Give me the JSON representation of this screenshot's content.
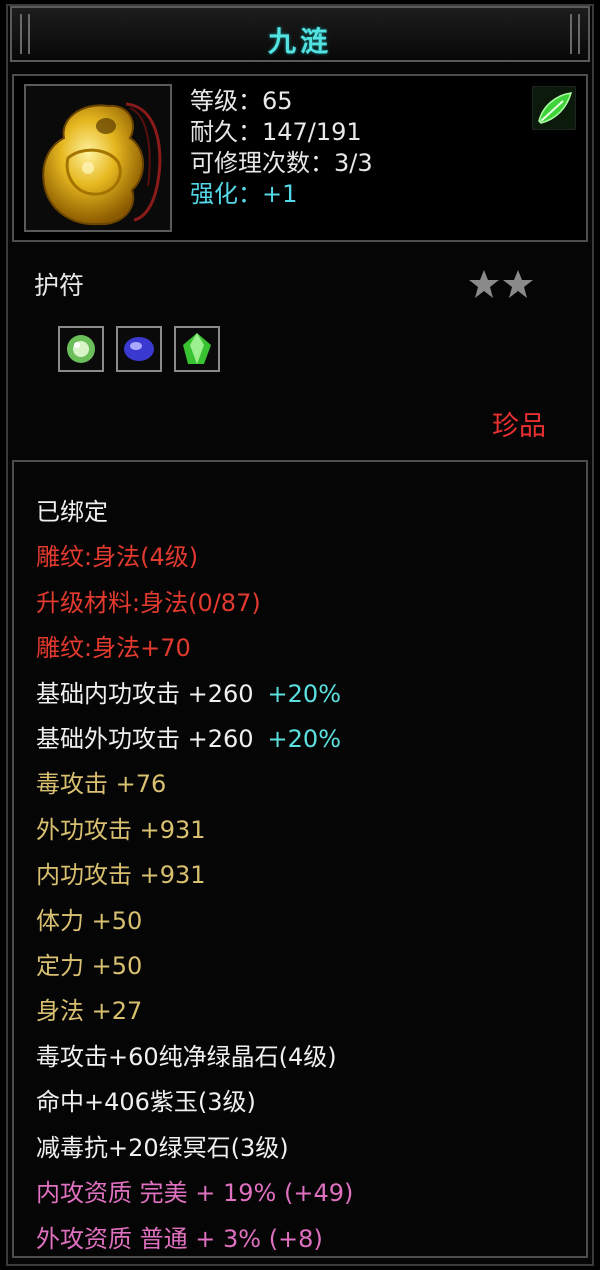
{
  "item": {
    "name": "九涟",
    "stats": [
      {
        "label": "等级：65"
      },
      {
        "label": "耐久：147/191"
      },
      {
        "label": "可修理次数：3/3"
      },
      {
        "label": "强化：+1"
      }
    ],
    "type": "护符",
    "stars": 2,
    "gem_icons": [
      "green-round-gem-icon",
      "blue-sapphire-gem-icon",
      "green-crystal-gem-icon"
    ],
    "rarity": "珍品"
  },
  "attributes": {
    "bound": "已绑定",
    "engrave": "雕纹:身法(4级)",
    "upgrade_material": "升级材料:身法(0/87)",
    "engrave_bonus": "雕纹:身法+70",
    "base_inner_atk": "基础内功攻击 +260",
    "base_inner_pct": "+20%",
    "base_outer_atk": "基础外功攻击 +260",
    "base_outer_pct": "+20%",
    "poison_atk": "毒攻击 +76",
    "outer_atk": "外功攻击 +931",
    "inner_atk": "内功攻击 +931",
    "stamina": "体力 +50",
    "focus": "定力 +50",
    "agility": "身法 +27",
    "gem1": "毒攻击+60纯净绿晶石(4级)",
    "gem2": "命中+406紫玉(3级)",
    "gem3": "减毒抗+20绿冥石(3级)",
    "inner_quality": "内攻资质 完美 + 19% (+49)",
    "outer_quality": "外攻资质 普通 + 3% (+8)"
  },
  "colors": {
    "title": "#53e3e3",
    "enhance": "#54d8e8",
    "rarity": "#e83030",
    "engrave": "#e23a2e",
    "gold": "#d8c070",
    "pink": "#e070c0"
  }
}
